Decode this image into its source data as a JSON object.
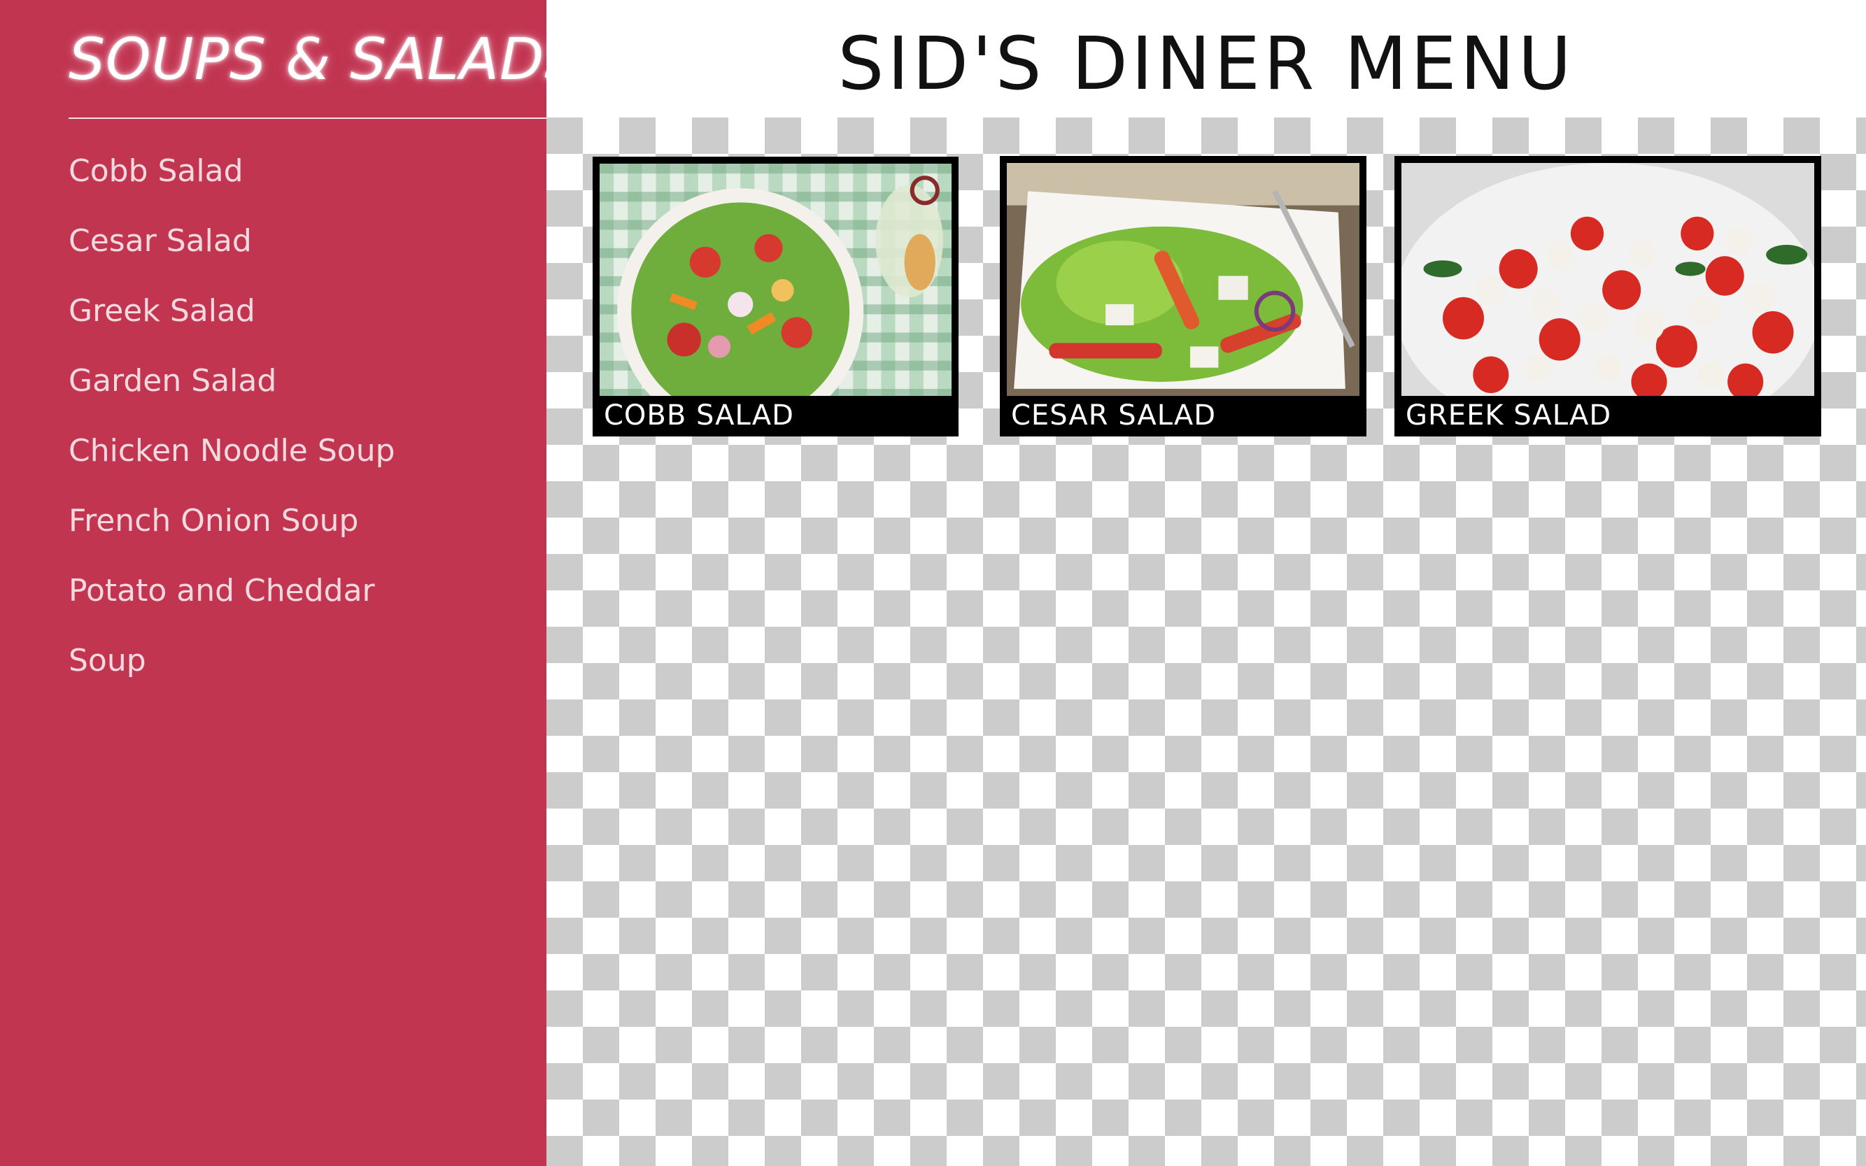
{
  "sidebar": {
    "title": "SOUPS & SALADS",
    "items": [
      {
        "label": "Cobb Salad"
      },
      {
        "label": "Cesar Salad"
      },
      {
        "label": "Greek Salad"
      },
      {
        "label": "Garden Salad"
      },
      {
        "label": "Chicken Noodle Soup"
      },
      {
        "label": "French Onion Soup"
      },
      {
        "label": "Potato and Cheddar"
      },
      {
        "label": "Soup"
      }
    ]
  },
  "header": {
    "title": "SID'S DINER MENU"
  },
  "cards": [
    {
      "caption": "COBB SALAD",
      "image": "cobb-salad-photo"
    },
    {
      "caption": "CESAR SALAD",
      "image": "cesar-salad-photo"
    },
    {
      "caption": "GREEK SALAD",
      "image": "greek-salad-photo"
    }
  ],
  "colors": {
    "sidebar_bg": "#c13551",
    "card_frame": "#000000",
    "checker_gray": "#cccccc"
  }
}
